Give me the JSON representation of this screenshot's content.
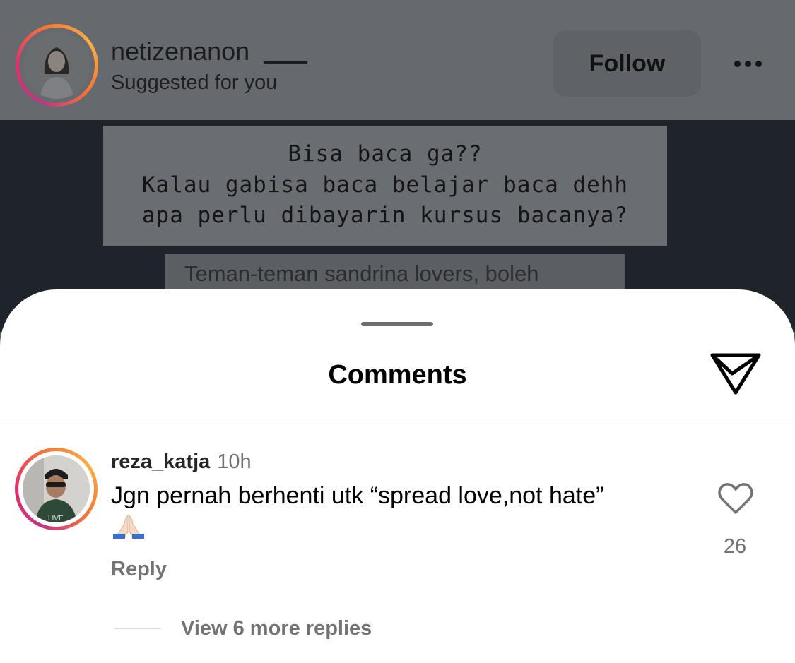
{
  "post": {
    "username": "netizenanon",
    "subtitle": "Suggested for you",
    "follow_label": "Follow",
    "more_icon": "more-horizontal-icon",
    "caption_lines": [
      "Bisa baca ga??",
      "Kalau gabisa baca belajar baca dehh",
      "apa perlu dibayarin kursus bacanya?"
    ],
    "overlay_text": "Teman-teman sandrina lovers, boleh"
  },
  "sheet": {
    "title": "Comments",
    "share_icon": "send-icon"
  },
  "comment": {
    "username": "reza_katja",
    "time": "10h",
    "text": "Jgn pernah berhenti utk “spread love,not hate”",
    "emoji": "folded-hands",
    "reply_label": "Reply",
    "like_icon": "heart-icon",
    "likes": "26",
    "view_replies": "View 6 more replies"
  },
  "colors": {
    "story_ring": [
      "#c13584",
      "#e1306c",
      "#f77737",
      "#fcaf45"
    ],
    "overlay_dim": "#5d6064",
    "secondary_text": "#737373"
  }
}
